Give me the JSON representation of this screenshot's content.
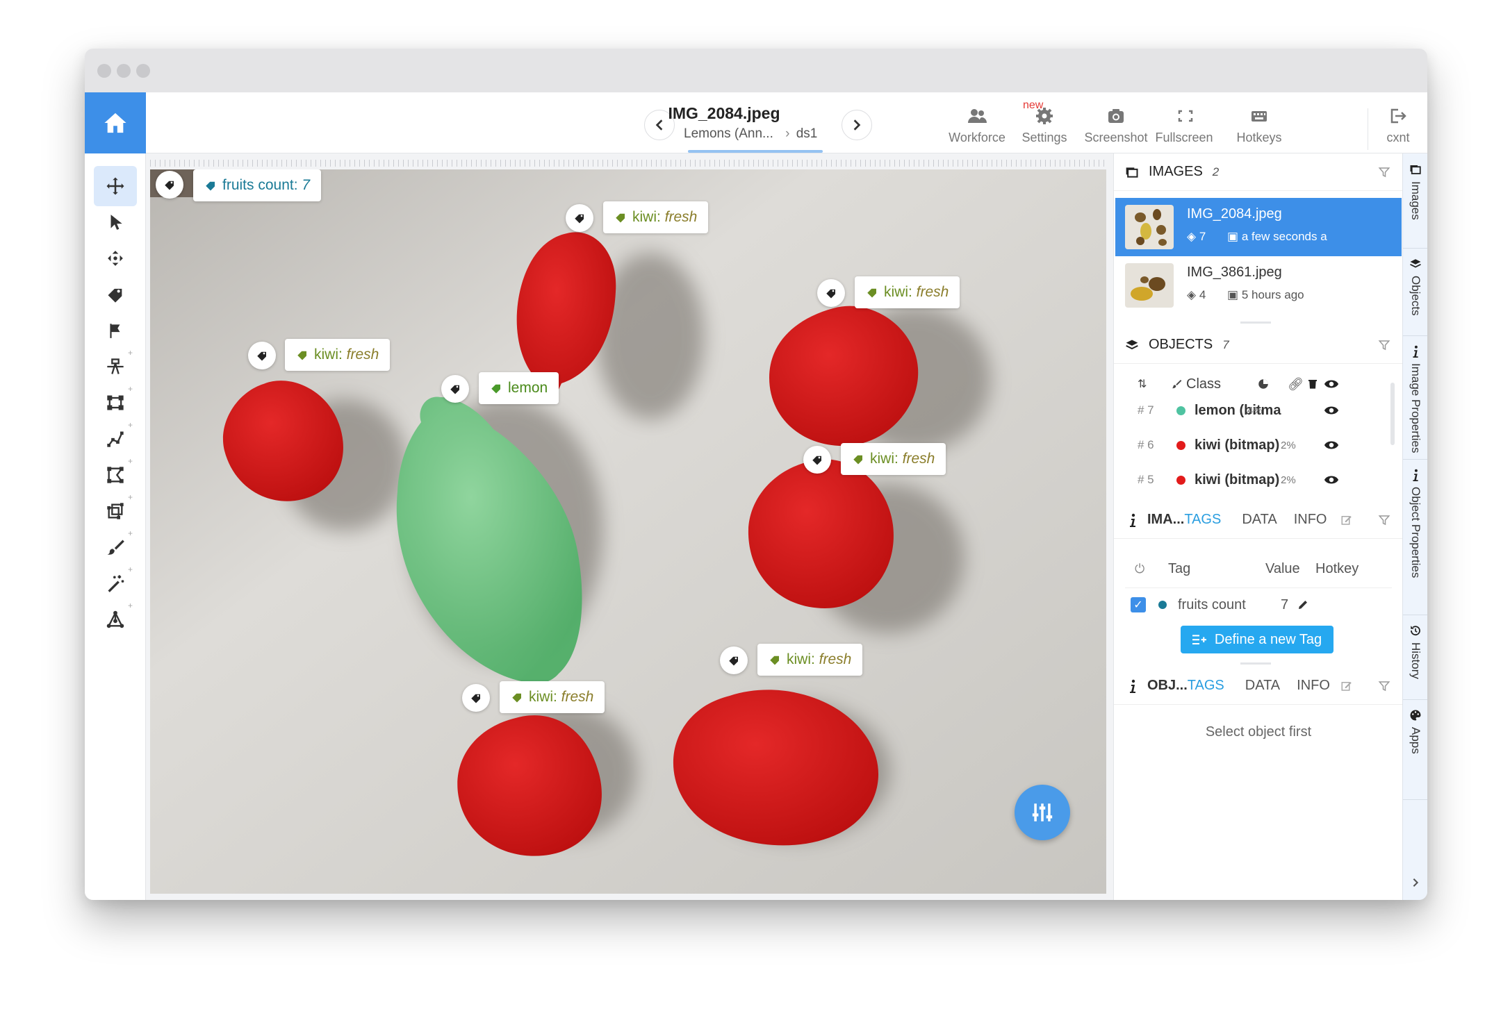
{
  "file": {
    "name": "IMG_2084.jpeg",
    "project": "Lemons (Ann...",
    "dataset": "ds1"
  },
  "toolbar": [
    {
      "label": "Workforce",
      "icon": "users-icon"
    },
    {
      "label": "Settings",
      "icon": "gear-icon"
    },
    {
      "label": "Screenshot",
      "icon": "camera-icon"
    },
    {
      "label": "Fullscreen",
      "icon": "fullscreen-icon"
    },
    {
      "label": "Hotkeys",
      "icon": "keyboard-icon"
    },
    {
      "label": "cxnt",
      "icon": "logout-icon"
    }
  ],
  "new_badge": "new",
  "canvas": {
    "image_tag": {
      "name": "fruits count",
      "value": "7"
    },
    "labels": [
      {
        "cls": "kiwi",
        "tag": "fresh"
      },
      {
        "cls": "kiwi",
        "tag": "fresh"
      },
      {
        "cls": "kiwi",
        "tag": "fresh"
      },
      {
        "cls": "lemon",
        "tag": ""
      },
      {
        "cls": "kiwi",
        "tag": "fresh"
      },
      {
        "cls": "kiwi",
        "tag": "fresh"
      },
      {
        "cls": "kiwi",
        "tag": "fresh"
      }
    ]
  },
  "images_panel": {
    "title": "IMAGES",
    "count": "2",
    "items": [
      {
        "name": "IMG_2084.jpeg",
        "objects": "7",
        "time": "a few seconds a"
      },
      {
        "name": "IMG_3861.jpeg",
        "objects": "4",
        "time": "5 hours ago"
      }
    ]
  },
  "objects_panel": {
    "title": "OBJECTS",
    "count": "7",
    "class_header": "Class",
    "rows": [
      {
        "id": "# 7",
        "name": "lemon (bitma",
        "pct": "4%",
        "color": "#4fc3a1"
      },
      {
        "id": "# 6",
        "name": "kiwi (bitmap)",
        "pct": "2%",
        "color": "#e21b1b"
      },
      {
        "id": "# 5",
        "name": "kiwi (bitmap)",
        "pct": "2%",
        "color": "#e21b1b"
      }
    ]
  },
  "image_props": {
    "title": "IMA...",
    "tabs": [
      "TAGS",
      "DATA",
      "INFO"
    ],
    "headers": {
      "tag": "Tag",
      "value": "Value",
      "hotkey": "Hotkey"
    },
    "tag_row": {
      "name": "fruits count",
      "value": "7",
      "color": "#1a7a96"
    },
    "define_btn": "Define a new Tag"
  },
  "object_props": {
    "title": "OBJ...",
    "tabs": [
      "TAGS",
      "DATA",
      "INFO"
    ],
    "empty": "Select object first"
  },
  "side_tabs": [
    "Images",
    "Objects",
    "Image Properties",
    "Object Properties",
    "History",
    "Apps"
  ]
}
